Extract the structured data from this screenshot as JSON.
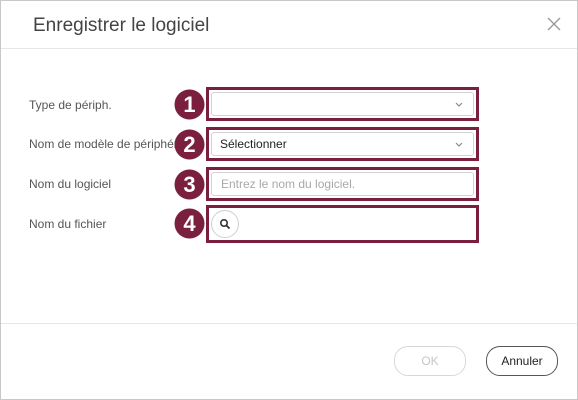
{
  "dialog": {
    "title": "Enregistrer le logiciel",
    "close_icon": "close-icon"
  },
  "form": {
    "fields": [
      {
        "label": "Type de périph.",
        "value": "",
        "badge": "1",
        "kind": "select"
      },
      {
        "label": "Nom de modèle de périphérique",
        "value": "Sélectionner",
        "badge": "2",
        "kind": "select"
      },
      {
        "label": "Nom du logiciel",
        "placeholder": "Entrez le nom du logiciel.",
        "value": "",
        "badge": "3",
        "kind": "text"
      },
      {
        "label": "Nom du fichier",
        "value": "",
        "badge": "4",
        "kind": "file",
        "icon": "search-icon"
      }
    ]
  },
  "footer": {
    "ok_label": "OK",
    "cancel_label": "Annuler"
  },
  "colors": {
    "highlight": "#7a1f3d",
    "badge": "#7a1f3d"
  }
}
